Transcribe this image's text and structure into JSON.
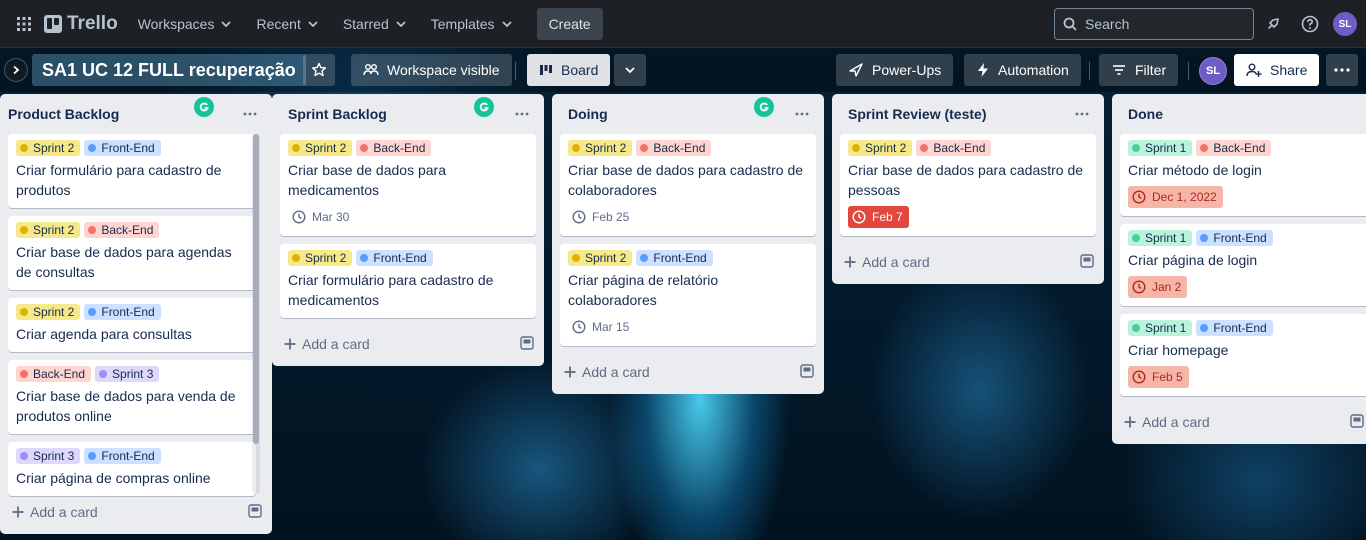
{
  "nav": {
    "logo": "Trello",
    "workspaces": "Workspaces",
    "recent": "Recent",
    "starred": "Starred",
    "templates": "Templates",
    "create": "Create",
    "search_placeholder": "Search",
    "avatar": "SL"
  },
  "board": {
    "title": "SA1 UC 12 FULL recuperação",
    "visibility": "Workspace visible",
    "view": "Board",
    "powerups": "Power-Ups",
    "automation": "Automation",
    "filter": "Filter",
    "avatar": "SL",
    "share": "Share"
  },
  "colors": {
    "sprint2": "#f5e989",
    "sprint2_dot": "#e2b203",
    "sprint1": "#baf3db",
    "sprint1_dot": "#4bce97",
    "sprint3": "#dfd8fd",
    "sprint3_dot": "#9f8fef",
    "frontend": "#cce0ff",
    "frontend_dot": "#579dff",
    "backend": "#ffd5d2",
    "backend_dot": "#f87168"
  },
  "lists": [
    {
      "title": "Product Backlog",
      "add_card": "Add a card",
      "cards": [
        {
          "labels": [
            "Sprint 2",
            "Front-End"
          ],
          "title": "Criar formulário para cadastro de produtos"
        },
        {
          "labels": [
            "Sprint 2",
            "Back-End"
          ],
          "title": "Criar base de dados para agendas de consultas"
        },
        {
          "labels": [
            "Sprint 2",
            "Front-End"
          ],
          "title": "Criar agenda para consultas"
        },
        {
          "labels": [
            "Back-End",
            "Sprint 3"
          ],
          "title": "Criar base de dados para venda de produtos online"
        },
        {
          "labels": [
            "Sprint 3",
            "Front-End"
          ],
          "title": "Criar página de compras online"
        }
      ]
    },
    {
      "title": "Sprint Backlog",
      "add_card": "Add a card",
      "cards": [
        {
          "labels": [
            "Sprint 2",
            "Back-End"
          ],
          "title": "Criar base de dados para medicamentos",
          "date": "Mar 30"
        },
        {
          "labels": [
            "Sprint 2",
            "Front-End"
          ],
          "title": "Criar formulário para cadastro de medicamentos"
        }
      ]
    },
    {
      "title": "Doing",
      "add_card": "Add a card",
      "cards": [
        {
          "labels": [
            "Sprint 2",
            "Back-End"
          ],
          "title": "Criar base de dados para cadastro de colaboradores",
          "date": "Feb 25"
        },
        {
          "labels": [
            "Sprint 2",
            "Front-End"
          ],
          "title": "Criar página de relatório colaboradores",
          "date": "Mar 15"
        }
      ]
    },
    {
      "title": "Sprint Review (teste)",
      "add_card": "Add a card",
      "cards": [
        {
          "labels": [
            "Sprint 2",
            "Back-End"
          ],
          "title": "Criar base de dados para cadastro de pessoas",
          "date": "Feb 7"
        }
      ]
    },
    {
      "title": "Done",
      "add_card": "Add a card",
      "cards": [
        {
          "labels": [
            "Sprint 1",
            "Back-End"
          ],
          "title": "Criar método de login",
          "date": "Dec 1, 2022"
        },
        {
          "labels": [
            "Sprint 1",
            "Front-End"
          ],
          "title": "Criar página de login",
          "date": "Jan 2"
        },
        {
          "labels": [
            "Sprint 1",
            "Front-End"
          ],
          "title": "Criar homepage",
          "date": "Feb 5"
        }
      ]
    }
  ]
}
